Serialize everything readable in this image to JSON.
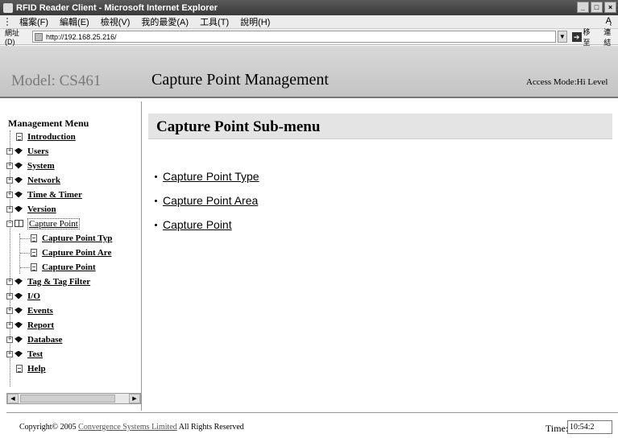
{
  "window": {
    "title": "RFID Reader Client - Microsoft Internet Explorer",
    "buttons": [
      "_",
      "□",
      "×"
    ]
  },
  "menubar": {
    "items": [
      "檔案(F)",
      "編輯(E)",
      "檢視(V)",
      "我的最愛(A)",
      "工具(T)",
      "說明(H)"
    ],
    "right_glyph": "Ą"
  },
  "address": {
    "label": "網址(D)",
    "url": "http://192.168.25.216/",
    "go_label": "移至",
    "links_label": "連結"
  },
  "header": {
    "model": "Model: CS461",
    "title": "Capture Point Management",
    "access": "Access Mode:Hi Level"
  },
  "sidebar": {
    "title": "Management Menu",
    "items": [
      {
        "label": "Introduction"
      },
      {
        "label": "Users"
      },
      {
        "label": "System"
      },
      {
        "label": "Network"
      },
      {
        "label": "Time & Timer"
      },
      {
        "label": "Version"
      },
      {
        "label": "Capture Point"
      },
      {
        "label": "Capture Point Typ"
      },
      {
        "label": "Capture Point Are"
      },
      {
        "label": "Capture Point"
      },
      {
        "label": "Tag & Tag Filter"
      },
      {
        "label": "I/O"
      },
      {
        "label": "Events"
      },
      {
        "label": "Report"
      },
      {
        "label": "Database"
      },
      {
        "label": "Test"
      },
      {
        "label": "Help"
      }
    ]
  },
  "main": {
    "heading": "Capture Point Sub-menu",
    "links": [
      "Capture Point Type",
      "Capture Point Area",
      "Capture Point"
    ]
  },
  "footer": {
    "copyright_prefix": "Copyright© 2005",
    "company": "Convergence Systems Limited",
    "rights": "All Rights Reserved",
    "time_label": "Time:",
    "time_value": "10:54:2"
  }
}
